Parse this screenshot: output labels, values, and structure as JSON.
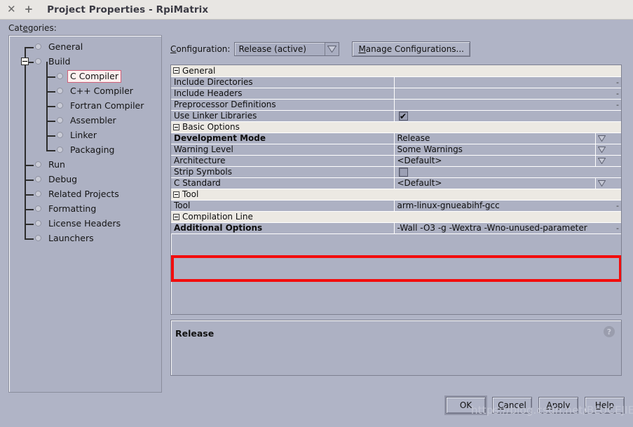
{
  "window": {
    "title": "Project Properties - RpiMatrix",
    "close_icon": "close-icon",
    "add_icon": "plus-icon"
  },
  "categories": {
    "label_prefix": "Cat",
    "label_mnemonic": "e",
    "label_suffix": "gories:",
    "label_full": "Categories:",
    "items": [
      {
        "label": "General",
        "level": 1,
        "expander": false,
        "selected": false
      },
      {
        "label": "Build",
        "level": 1,
        "expander": true,
        "selected": false
      },
      {
        "label": "C Compiler",
        "level": 2,
        "expander": false,
        "selected": true
      },
      {
        "label": "C++ Compiler",
        "level": 2,
        "expander": false,
        "selected": false
      },
      {
        "label": "Fortran Compiler",
        "level": 2,
        "expander": false,
        "selected": false
      },
      {
        "label": "Assembler",
        "level": 2,
        "expander": false,
        "selected": false
      },
      {
        "label": "Linker",
        "level": 2,
        "expander": false,
        "selected": false
      },
      {
        "label": "Packaging",
        "level": 2,
        "expander": false,
        "selected": false
      },
      {
        "label": "Run",
        "level": 1,
        "expander": false,
        "selected": false
      },
      {
        "label": "Debug",
        "level": 1,
        "expander": false,
        "selected": false
      },
      {
        "label": "Related Projects",
        "level": 1,
        "expander": false,
        "selected": false
      },
      {
        "label": "Formatting",
        "level": 1,
        "expander": false,
        "selected": false
      },
      {
        "label": "License Headers",
        "level": 1,
        "expander": false,
        "selected": false
      },
      {
        "label": "Launchers",
        "level": 1,
        "expander": false,
        "selected": false
      }
    ]
  },
  "config": {
    "label": "Configuration:",
    "label_mnemonic": "C",
    "label_rest": "onfiguration:",
    "value": "Release (active)",
    "dropdown_icon": "chevron-down-icon",
    "manage_button": "Manage Configurations...",
    "manage_button_mnemonic": "M",
    "manage_button_rest": "anage Configurations..."
  },
  "properties": [
    {
      "kind": "group",
      "name": "General"
    },
    {
      "kind": "prop",
      "name": "Include Directories",
      "value": "",
      "tail": "-",
      "bold": false,
      "widget": "text"
    },
    {
      "kind": "prop",
      "name": "Include Headers",
      "value": "",
      "tail": "-",
      "bold": false,
      "widget": "text"
    },
    {
      "kind": "prop",
      "name": "Preprocessor Definitions",
      "value": "",
      "tail": "-",
      "bold": false,
      "widget": "text"
    },
    {
      "kind": "prop",
      "name": "Use Linker Libraries",
      "value": "",
      "tail": "",
      "bold": false,
      "widget": "checkbox",
      "checked": true
    },
    {
      "kind": "group",
      "name": "Basic Options"
    },
    {
      "kind": "prop",
      "name": "Development Mode",
      "value": "Release",
      "tail": "",
      "bold": true,
      "widget": "combo"
    },
    {
      "kind": "prop",
      "name": "Warning Level",
      "value": "Some Warnings",
      "tail": "",
      "bold": false,
      "widget": "combo"
    },
    {
      "kind": "prop",
      "name": "Architecture",
      "value": "<Default>",
      "tail": "",
      "bold": false,
      "widget": "combo"
    },
    {
      "kind": "prop",
      "name": "Strip Symbols",
      "value": "",
      "tail": "",
      "bold": false,
      "widget": "checkbox",
      "checked": false
    },
    {
      "kind": "prop",
      "name": "C Standard",
      "value": "<Default>",
      "tail": "",
      "bold": false,
      "widget": "combo"
    },
    {
      "kind": "group",
      "name": "Tool"
    },
    {
      "kind": "prop",
      "name": "Tool",
      "value": "arm-linux-gnueabihf-gcc",
      "tail": "-",
      "bold": false,
      "widget": "text"
    },
    {
      "kind": "group",
      "name": "Compilation Line"
    },
    {
      "kind": "prop",
      "name": "Additional Options",
      "value": "-Wall -O3 -g -Wextra -Wno-unused-parameter",
      "tail": "-",
      "bold": true,
      "widget": "text"
    }
  ],
  "description": {
    "text": "Release",
    "help_icon": "help-icon"
  },
  "buttons": [
    {
      "label": "OK",
      "mnemonic": "",
      "rest": "OK",
      "default": true
    },
    {
      "label": "Cancel",
      "mnemonic": "C",
      "rest": "ancel",
      "default": false
    },
    {
      "label": "Apply",
      "mnemonic": "A",
      "rest": "pply",
      "default": false
    },
    {
      "label": "Help",
      "mnemonic": "H",
      "rest": "elp",
      "default": false
    }
  ],
  "watermark": "https://blog.csdn.net/BLUCEJIE",
  "colors": {
    "panel": "#b0b4c6",
    "list_bg": "#adb1c3",
    "group_bg": "#ece9e3",
    "titlebar": "#e8e6e3",
    "highlight_red": "#f20d0d",
    "selection_border": "#d0607a"
  }
}
